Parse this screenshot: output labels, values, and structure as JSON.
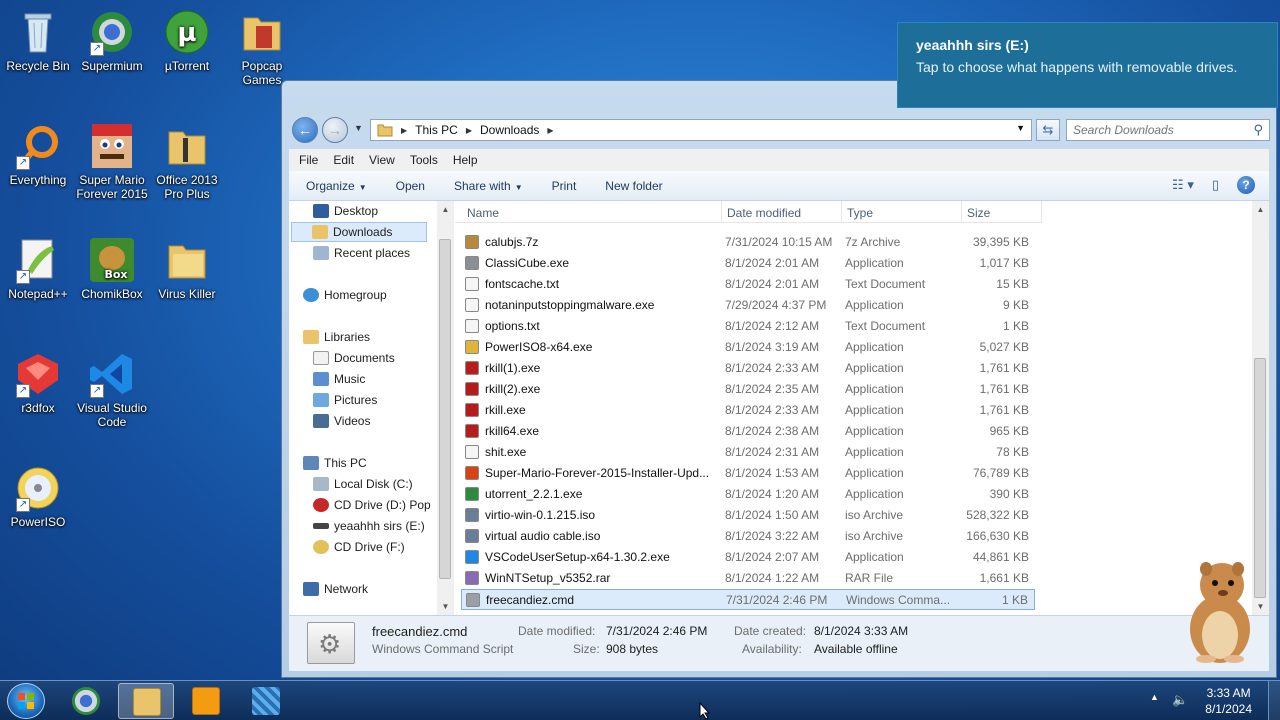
{
  "desktop": {
    "icons": [
      {
        "label": "Recycle Bin"
      },
      {
        "label": "Supermium"
      },
      {
        "label": "µTorrent"
      },
      {
        "label": "Popcap Games"
      },
      {
        "label": "Everything"
      },
      {
        "label": "Super Mario Forever 2015"
      },
      {
        "label": "Office 2013 Pro Plus"
      },
      {
        "label": "Notepad++"
      },
      {
        "label": "ChomikBox"
      },
      {
        "label": "Virus Killer"
      },
      {
        "label": "r3dfox"
      },
      {
        "label": "Visual Studio Code"
      },
      {
        "label": "PowerISO"
      }
    ]
  },
  "notification": {
    "title": "yeaahhh sirs (E:)",
    "body": "Tap to choose what happens with removable drives."
  },
  "explorer": {
    "breadcrumb": [
      "This PC",
      "Downloads"
    ],
    "search_placeholder": "Search Downloads",
    "menu": [
      "File",
      "Edit",
      "View",
      "Tools",
      "Help"
    ],
    "toolbar": [
      "Organize",
      "Open",
      "Share with",
      "Print",
      "New folder"
    ],
    "nav": [
      {
        "label": "Desktop"
      },
      {
        "label": "Downloads"
      },
      {
        "label": "Recent places"
      },
      {
        "label": "Homegroup"
      },
      {
        "label": "Libraries"
      },
      {
        "label": "Documents"
      },
      {
        "label": "Music"
      },
      {
        "label": "Pictures"
      },
      {
        "label": "Videos"
      },
      {
        "label": "This PC"
      },
      {
        "label": "Local Disk (C:)"
      },
      {
        "label": "CD Drive (D:) Pop"
      },
      {
        "label": "yeaahhh sirs (E:)"
      },
      {
        "label": "CD Drive (F:)"
      },
      {
        "label": "Network"
      }
    ],
    "columns": [
      "Name",
      "Date modified",
      "Type",
      "Size"
    ],
    "files": [
      {
        "name": "calubjs.7z",
        "date": "7/31/2024 10:15 AM",
        "type": "7z Archive",
        "size": "39,395 KB"
      },
      {
        "name": "ClassiCube.exe",
        "date": "8/1/2024 2:01 AM",
        "type": "Application",
        "size": "1,017 KB"
      },
      {
        "name": "fontscache.txt",
        "date": "8/1/2024 2:01 AM",
        "type": "Text Document",
        "size": "15 KB"
      },
      {
        "name": "notaninputstoppingmalware.exe",
        "date": "7/29/2024 4:37 PM",
        "type": "Application",
        "size": "9 KB"
      },
      {
        "name": "options.txt",
        "date": "8/1/2024 2:12 AM",
        "type": "Text Document",
        "size": "1 KB"
      },
      {
        "name": "PowerISO8-x64.exe",
        "date": "8/1/2024 3:19 AM",
        "type": "Application",
        "size": "5,027 KB"
      },
      {
        "name": "rkill(1).exe",
        "date": "8/1/2024 2:33 AM",
        "type": "Application",
        "size": "1,761 KB"
      },
      {
        "name": "rkill(2).exe",
        "date": "8/1/2024 2:35 AM",
        "type": "Application",
        "size": "1,761 KB"
      },
      {
        "name": "rkill.exe",
        "date": "8/1/2024 2:33 AM",
        "type": "Application",
        "size": "1,761 KB"
      },
      {
        "name": "rkill64.exe",
        "date": "8/1/2024 2:38 AM",
        "type": "Application",
        "size": "965 KB"
      },
      {
        "name": "shit.exe",
        "date": "8/1/2024 2:31 AM",
        "type": "Application",
        "size": "78 KB"
      },
      {
        "name": "Super-Mario-Forever-2015-Installer-Upd...",
        "date": "8/1/2024 1:53 AM",
        "type": "Application",
        "size": "76,789 KB"
      },
      {
        "name": "utorrent_2.2.1.exe",
        "date": "8/1/2024 1:20 AM",
        "type": "Application",
        "size": "390 KB"
      },
      {
        "name": "virtio-win-0.1.215.iso",
        "date": "8/1/2024 1:50 AM",
        "type": "iso Archive",
        "size": "528,322 KB"
      },
      {
        "name": "virtual audio cable.iso",
        "date": "8/1/2024 3:22 AM",
        "type": "iso Archive",
        "size": "166,630 KB"
      },
      {
        "name": "VSCodeUserSetup-x64-1.30.2.exe",
        "date": "8/1/2024 2:07 AM",
        "type": "Application",
        "size": "44,861 KB"
      },
      {
        "name": "WinNTSetup_v5352.rar",
        "date": "8/1/2024 1:22 AM",
        "type": "RAR File",
        "size": "1,661 KB"
      },
      {
        "name": "freecandiez.cmd",
        "date": "7/31/2024 2:46 PM",
        "type": "Windows Comma...",
        "size": "1 KB"
      }
    ],
    "details": {
      "name": "freecandiez.cmd",
      "type": "Windows Command Script",
      "modified_label": "Date modified:",
      "modified": "7/31/2024 2:46 PM",
      "size_label": "Size:",
      "size": "908 bytes",
      "created_label": "Date created:",
      "created": "8/1/2024 3:33 AM",
      "avail_label": "Availability:",
      "avail": "Available offline"
    }
  },
  "taskbar": {
    "time": "3:33 AM",
    "date": "8/1/2024"
  },
  "colors": {
    "accent": "#1e6e9a",
    "selection": "#dcebfc"
  }
}
